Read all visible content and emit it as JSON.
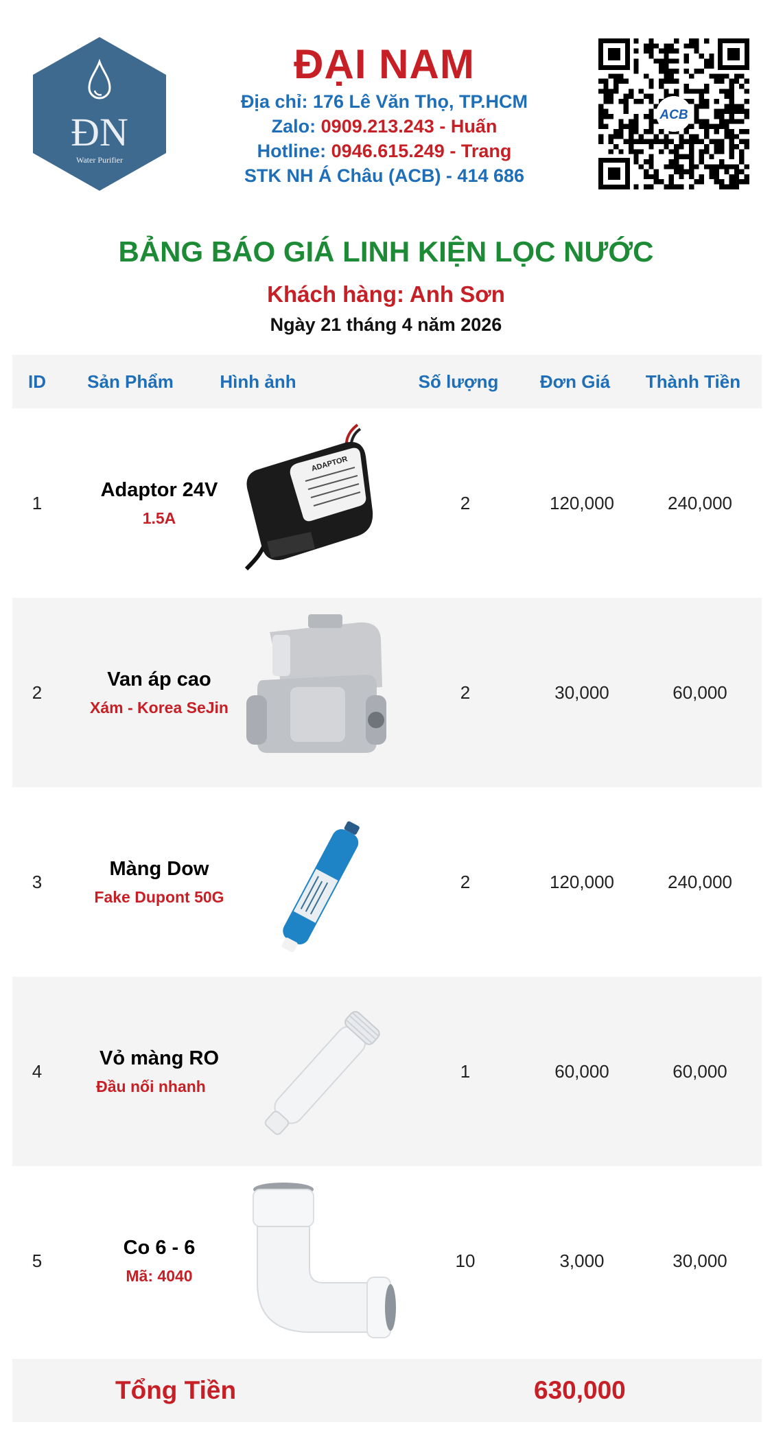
{
  "logo": {
    "initials": "ĐN",
    "tagline": "Water Purifier"
  },
  "company": {
    "name": "ĐẠI NAM",
    "address_label": "Địa chỉ: ",
    "address": "176 Lê Văn Thọ, TP.HCM",
    "zalo_label": "Zalo: ",
    "zalo": "0909.213.243 - Huấn",
    "hotline_label": "Hotline: ",
    "hotline": "0946.615.249 - Trang",
    "bank": "STK NH Á Châu (ACB) - 414 686"
  },
  "qr": {
    "badge": "ACB"
  },
  "title": "BẢNG BÁO GIÁ LINH KIỆN LỌC NƯỚC",
  "customer": "Khách hàng: Anh Sơn",
  "date": "Ngày 21 tháng 4 năm 2026",
  "table": {
    "headers": [
      "ID",
      "Sản Phẩm",
      "Hình ảnh",
      "Số lượng",
      "Đơn Giá",
      "Thành Tiền"
    ],
    "rows": [
      {
        "id": "1",
        "name": "Adaptor 24V",
        "desc": "1.5A",
        "qty": "2",
        "price": "120,000",
        "amount": "240,000",
        "image": "adaptor-image"
      },
      {
        "id": "2",
        "name": "Van áp cao",
        "desc": "Xám - Korea SeJin",
        "qty": "2",
        "price": "30,000",
        "amount": "60,000",
        "image": "high-pressure-valve-image"
      },
      {
        "id": "3",
        "name": "Màng Dow",
        "desc": "Fake Dupont 50G",
        "qty": "2",
        "price": "120,000",
        "amount": "240,000",
        "image": "ro-membrane-image"
      },
      {
        "id": "4",
        "name": "Vỏ màng RO",
        "desc": "Đầu nối nhanh",
        "qty": "1",
        "price": "60,000",
        "amount": "60,000",
        "image": "ro-housing-image"
      },
      {
        "id": "5",
        "name": "Co 6 - 6",
        "desc": "Mã: 4040",
        "qty": "10",
        "price": "3,000",
        "amount": "30,000",
        "image": "elbow-fitting-image"
      }
    ]
  },
  "adaptor_label": "ADAPTOR",
  "total": {
    "label": "Tổng Tiền",
    "value": "630,000"
  },
  "colors": {
    "brand_red": "#c62026",
    "brand_blue": "#1e6fb8",
    "title_green": "#1d8a36",
    "row_alt": "#f4f4f4"
  }
}
